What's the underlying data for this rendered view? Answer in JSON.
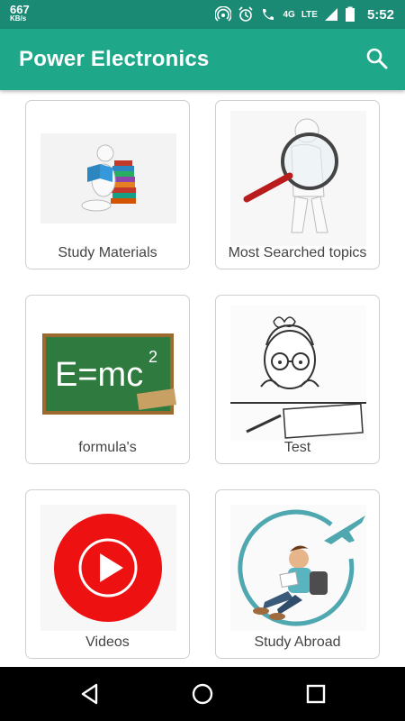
{
  "status_bar": {
    "net_speed_value": "667",
    "net_speed_unit": "KB/s",
    "network_4g": "4G",
    "network_lte": "LTE",
    "time": "5:52"
  },
  "app_bar": {
    "title": "Power Electronics",
    "search_icon": "search-icon"
  },
  "colors": {
    "status_bar": "#1a8a74",
    "app_bar": "#1fa78a",
    "nav_bar": "#000000"
  },
  "cards": [
    {
      "label": "Study Materials",
      "icon": "reading-figure-illustration"
    },
    {
      "label": "Most Searched topics",
      "icon": "magnifier-figure-illustration"
    },
    {
      "label": "formula's",
      "icon": "chalkboard-illustration"
    },
    {
      "label": "Test",
      "icon": "student-test-illustration"
    },
    {
      "label": "Videos",
      "icon": "play-button-illustration"
    },
    {
      "label": "Study Abroad",
      "icon": "student-airplane-illustration"
    }
  ],
  "chalkboard": {
    "text": "E=mc",
    "superscript": "2"
  },
  "nav": {
    "back": "back-icon",
    "home": "home-icon",
    "recents": "recents-icon"
  }
}
